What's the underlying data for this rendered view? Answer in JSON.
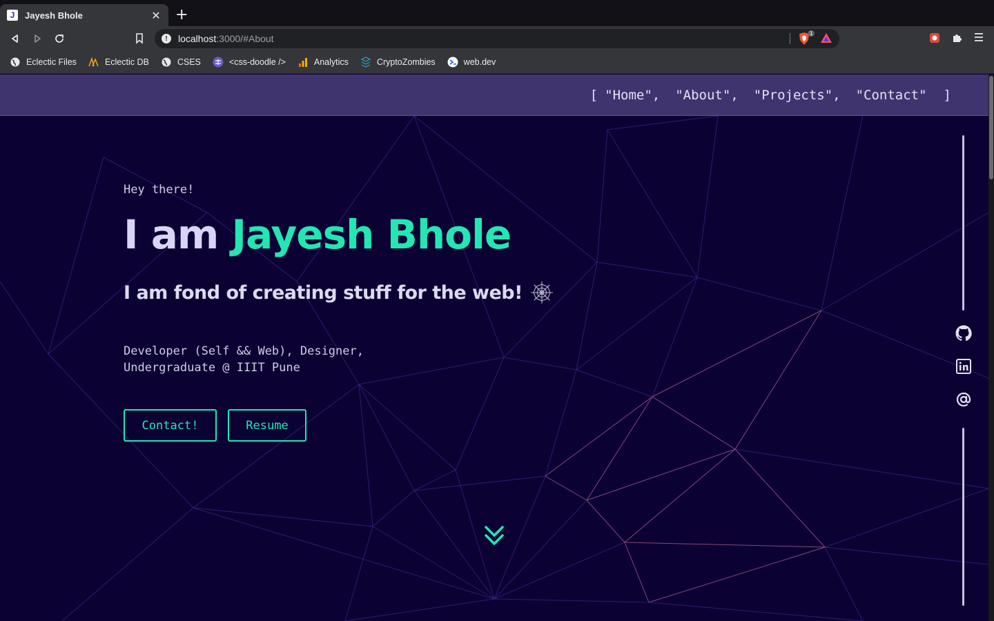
{
  "browser": {
    "tab": {
      "title": "Jayesh Bhole",
      "favicon": "J"
    },
    "url": {
      "host": "localhost",
      "rest": ":3000/#About"
    },
    "shield_count": "1",
    "bookmarks": [
      {
        "label": "Eclectic Files",
        "icon": "globe-icon"
      },
      {
        "label": "Eclectic DB",
        "icon": "eclectic-db-icon"
      },
      {
        "label": "CSES",
        "icon": "globe-icon"
      },
      {
        "label": "<css-doodle />",
        "icon": "css-doodle-icon"
      },
      {
        "label": "Analytics",
        "icon": "analytics-icon"
      },
      {
        "label": "CryptoZombies",
        "icon": "cryptozombies-icon"
      },
      {
        "label": "web.dev",
        "icon": "webdev-icon"
      }
    ]
  },
  "nav": {
    "open": "[",
    "close": "]",
    "items": [
      "\"Home\"",
      "\"About\"",
      "\"Projects\"",
      "\"Contact\""
    ],
    "separator": ","
  },
  "hero": {
    "greeting": "Hey there!",
    "headline_prefix": "I am ",
    "name": "Jayesh Bhole",
    "tagline": "I am fond of creating stuff for the web!",
    "desc_line1": "Developer (Self && Web), Designer,",
    "desc_line2": "Undergraduate @ IIIT Pune",
    "contact_label": "Contact!",
    "resume_label": "Resume"
  },
  "social": [
    "github-icon",
    "linkedin-icon",
    "email-icon"
  ],
  "colors": {
    "background": "#0b0233",
    "accent": "#23e6b5",
    "heading": "#d9d6f5"
  }
}
